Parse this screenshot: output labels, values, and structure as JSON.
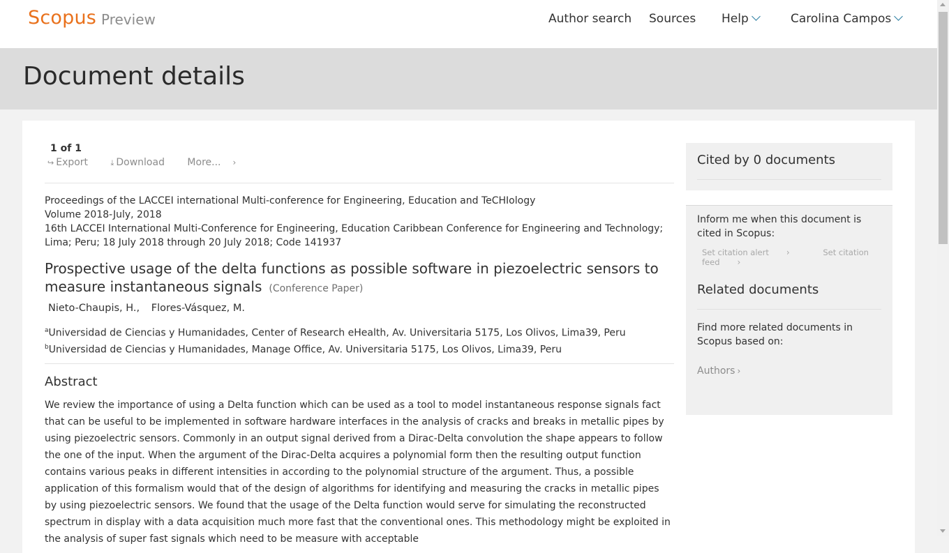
{
  "header": {
    "logo": "Scopus",
    "logo_sub": "Preview",
    "nav": {
      "author_search": "Author search",
      "sources": "Sources",
      "help": "Help",
      "user": "Carolina Campos"
    }
  },
  "page_title": "Document details",
  "result_count": "1 of 1",
  "actions": {
    "export": "Export",
    "download": "Download",
    "more": "More..."
  },
  "source": {
    "line1": "Proceedings of the LACCEI international Multi-conference for Engineering, Education and TeCHIology",
    "line2": "Volume 2018-July, 2018",
    "line3": "16th LACCEI International Multi-Conference for Engineering, Education Caribbean Conference for Engineering and Technology; Lima; Peru; 18 July 2018 through 20 July 2018; Code 141937"
  },
  "document": {
    "title": "Prospective usage of the delta functions as possible software in piezoelectric sensors to measure instantaneous signals",
    "type": "(Conference Paper)"
  },
  "authors": [
    "Nieto-Chaupis, H.,",
    "Flores-Vásquez, M."
  ],
  "affiliations": [
    {
      "sup": "a",
      "text": "Universidad de Ciencias y Humanidades, Center of Research eHealth, Av. Universitaria 5175, Los Olivos, Lima39, Peru"
    },
    {
      "sup": "b",
      "text": "Universidad de Ciencias y Humanidades, Manage Office, Av. Universitaria 5175, Los Olivos, Lima39, Peru"
    }
  ],
  "abstract": {
    "heading": "Abstract",
    "text": "We review the importance of using a Delta function which can be used as a tool to model instantaneous response signals fact that can be useful to be implemented in software hardware interfaces in the analysis of cracks and breaks in metallic pipes by using piezoelectric sensors. Commonly in an output signal derived from a Dirac-Delta convolution the shape appears to follow the one of the input. When the argument of the Dirac-Delta acquires a polynomial form then the resulting output function contains various peaks in different intensities in according to the polynomial structure of the argument. Thus, a possible application of this formalism would that of the design of algorithms for identifying and measuring the cracks in metallic pipes by using piezoelectric sensors. We found that the usage of the Delta function would serve for simulating the reconstructed spectrum in display with a data acquisition much more fast that the conventional ones. This methodology might be exploited in the analysis of super fast signals which need to be measure with acceptable"
  },
  "sidebar": {
    "cited_by": "Cited by 0 documents",
    "inform": "Inform me when this document is cited in Scopus:",
    "set_alert": "Set citation alert",
    "set_feed": "Set citation feed",
    "related_heading": "Related documents",
    "find_more": "Find more related documents in Scopus based on:",
    "authors_link": "Authors"
  }
}
